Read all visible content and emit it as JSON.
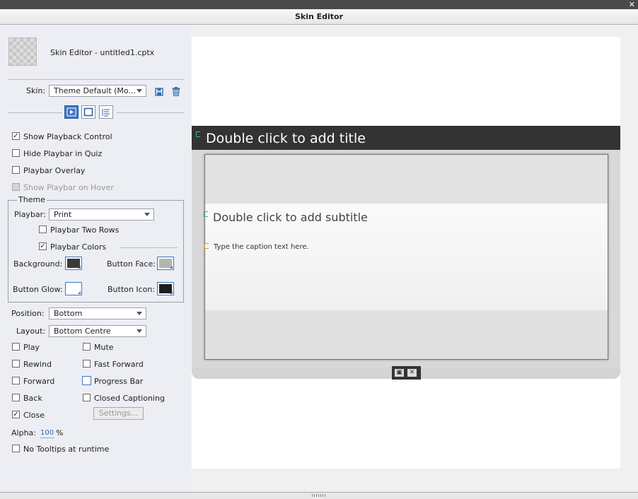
{
  "window": {
    "title": "Skin Editor",
    "close_glyph": "✕"
  },
  "header": {
    "file_label": "Skin Editor - untitled1.cptx"
  },
  "skin": {
    "label": "Skin:",
    "value": "Theme Default (Mo..."
  },
  "tabs": [
    {
      "name": "playback",
      "active": true
    },
    {
      "name": "borders",
      "active": false
    },
    {
      "name": "toc",
      "active": false
    }
  ],
  "options": {
    "show_playback_control": {
      "label": "Show Playback Control",
      "checked": true
    },
    "hide_playbar_in_quiz": {
      "label": "Hide Playbar in Quiz",
      "checked": false
    },
    "playbar_overlay": {
      "label": "Playbar Overlay",
      "checked": false
    },
    "show_playbar_on_hover": {
      "label": "Show Playbar on Hover",
      "checked": false,
      "disabled": true
    }
  },
  "theme": {
    "legend": "Theme",
    "playbar_label": "Playbar:",
    "playbar_value": "Print",
    "two_rows": {
      "label": "Playbar Two Rows",
      "checked": false
    },
    "playbar_colors": {
      "label": "Playbar Colors",
      "checked": true
    },
    "background_label": "Background:",
    "button_face_label": "Button Face:",
    "button_glow_label": "Button Glow:",
    "button_icon_label": "Button Icon:",
    "colors": {
      "background": "#3a3a3a",
      "button_face": "#b4b4b4",
      "button_glow": "#ffffff",
      "button_icon": "#1e1e1e"
    }
  },
  "position": {
    "label": "Position:",
    "value": "Bottom"
  },
  "layout": {
    "label": "Layout:",
    "value": "Bottom Centre"
  },
  "controls": {
    "play": {
      "label": "Play",
      "checked": false
    },
    "mute": {
      "label": "Mute",
      "checked": false
    },
    "rewind": {
      "label": "Rewind",
      "checked": false
    },
    "fast_forward": {
      "label": "Fast Forward",
      "checked": false
    },
    "forward": {
      "label": "Forward",
      "checked": false
    },
    "progress_bar": {
      "label": "Progress Bar",
      "checked": false
    },
    "back": {
      "label": "Back",
      "checked": false
    },
    "closed_captioning": {
      "label": "Closed Captioning",
      "checked": false
    },
    "close": {
      "label": "Close",
      "checked": true
    },
    "settings_button": "Settings..."
  },
  "alpha": {
    "label": "Alpha:",
    "value": "100",
    "unit": "%"
  },
  "no_tooltips": {
    "label": "No Tooltips at runtime",
    "checked": false
  },
  "preview": {
    "title_placeholder": "Double click to add title",
    "subtitle_placeholder": "Double click to add subtitle",
    "caption_placeholder": "Type the caption text here."
  },
  "icons": {
    "save": "save-icon",
    "delete": "trash-icon",
    "playbar_ctrl_1": "print-icon",
    "playbar_ctrl_2": "close-icon"
  }
}
